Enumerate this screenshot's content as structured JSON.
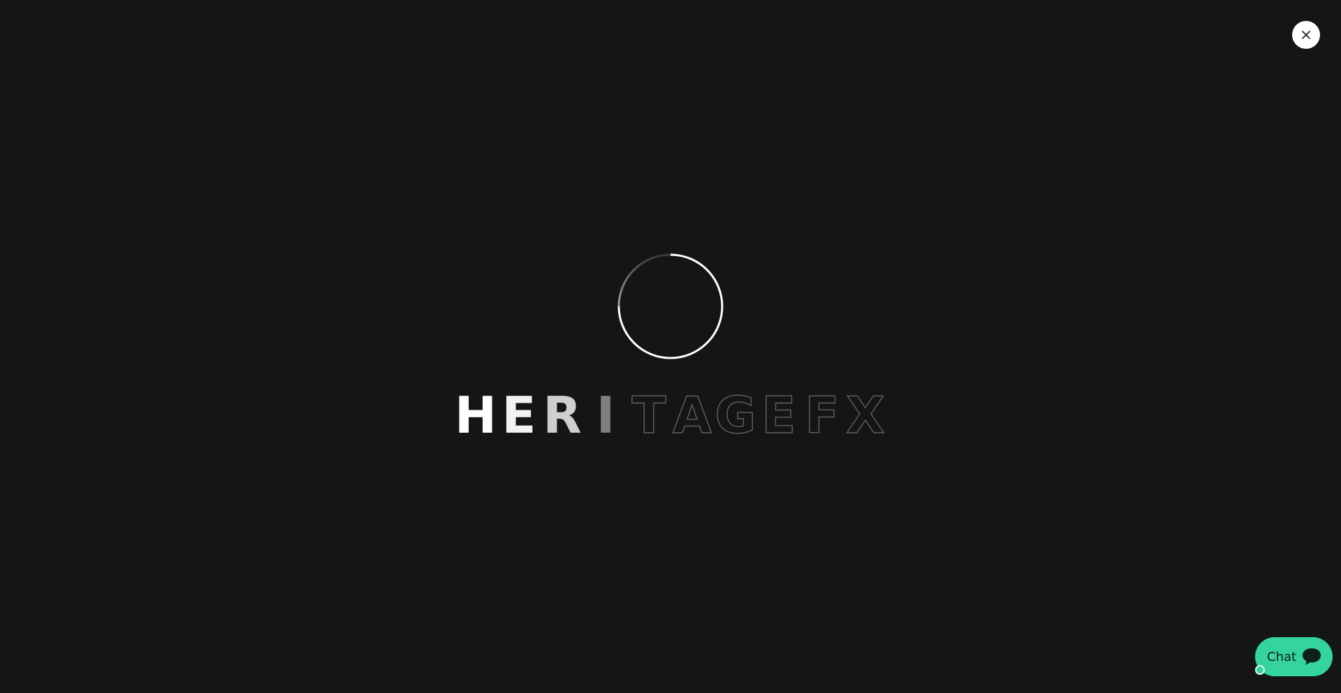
{
  "overlay": {
    "close_icon": "close-icon",
    "accent_color": "#34d3a0",
    "background_color": "#141615"
  },
  "loader": {
    "spinner_icon": "loading-spinner-icon",
    "brand_name": "HERITAGEFX",
    "filled_letters": 4
  },
  "chat": {
    "label": "Chat",
    "icon": "chat-bubble-icon",
    "status": "online-status-dot"
  }
}
